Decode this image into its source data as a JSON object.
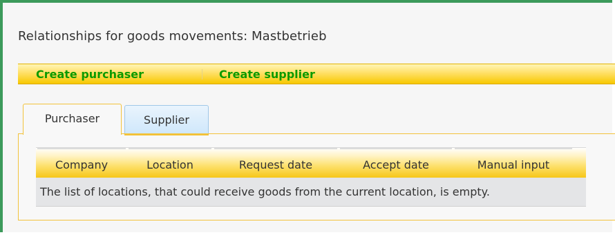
{
  "page": {
    "title": "Relationships for goods movements: Mastbetrieb"
  },
  "toolbar": {
    "create_purchaser": "Create purchaser",
    "create_supplier": "Create supplier"
  },
  "tabs": [
    {
      "label": "Purchaser",
      "active": true
    },
    {
      "label": "Supplier",
      "active": false
    }
  ],
  "grid": {
    "columns": [
      "Company",
      "Location",
      "Request date",
      "Accept date",
      "Manual input"
    ],
    "empty_message": "The list of locations, that could receive goods from the current location, is empty."
  },
  "colors": {
    "frame_green": "#3c9a5b",
    "link_green": "#0c9a00",
    "accent_yellow": "#f6c514",
    "tab_blue": "#cfe7fb"
  }
}
